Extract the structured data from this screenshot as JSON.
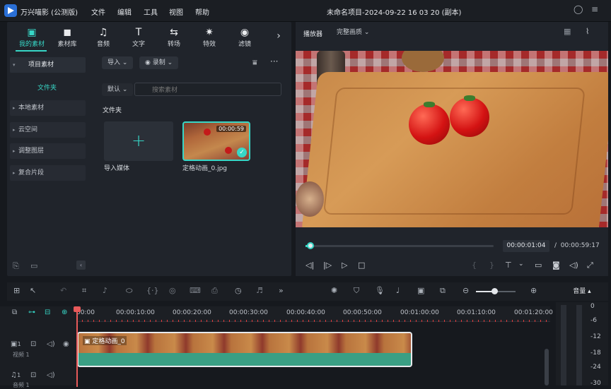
{
  "app": {
    "title": "万兴喵影 (公测版)",
    "project": "未命名项目-2024-09-22 16 03 20 (副本)"
  },
  "menu": [
    "文件",
    "编辑",
    "工具",
    "视图",
    "帮助"
  ],
  "tabs": [
    {
      "label": "我的素材",
      "icon": "▣"
    },
    {
      "label": "素材库",
      "icon": "◼"
    },
    {
      "label": "音频",
      "icon": "♫"
    },
    {
      "label": "文字",
      "icon": "T"
    },
    {
      "label": "转场",
      "icon": "⇆"
    },
    {
      "label": "特效",
      "icon": "✷"
    },
    {
      "label": "滤镜",
      "icon": "◉"
    }
  ],
  "tabs_more": "›",
  "tree": [
    {
      "label": "项目素材",
      "expanded": true
    },
    {
      "label": "本地素材"
    },
    {
      "label": "云空间"
    },
    {
      "label": "调整图层"
    },
    {
      "label": "复合片段"
    }
  ],
  "tree_folder": "文件夹",
  "toolbar": {
    "import": "导入",
    "record": "录制",
    "filter_icon": "filter-icon",
    "more": "···"
  },
  "sort": {
    "label": "默认"
  },
  "search": {
    "placeholder": "搜索素材"
  },
  "section_title": "文件夹",
  "media": [
    {
      "label": "导入媒体",
      "type": "import"
    },
    {
      "label": "定格动画_0.jpg",
      "duration": "00:00:59",
      "selected": true
    }
  ],
  "player": {
    "tab": "播放器",
    "quality": "完整画质",
    "current": "00:00:01:04",
    "separator": "/",
    "total": "00:00:59:17",
    "progress": 0.02
  },
  "volume": {
    "label": "音量"
  },
  "ruler": [
    "00:00",
    "00:00:10:00",
    "00:00:20:00",
    "00:00:30:00",
    "00:00:40:00",
    "00:00:50:00",
    "00:01:00:00",
    "00:01:10:00",
    "00:01:20:00"
  ],
  "tracks": [
    {
      "num": "1",
      "name": "视频 1"
    },
    {
      "num": "1",
      "name": "音频 1"
    }
  ],
  "clip": {
    "label": "定格动画_0"
  },
  "meter_db": [
    "0",
    "-6",
    "-12",
    "-18",
    "-24",
    "-30"
  ]
}
